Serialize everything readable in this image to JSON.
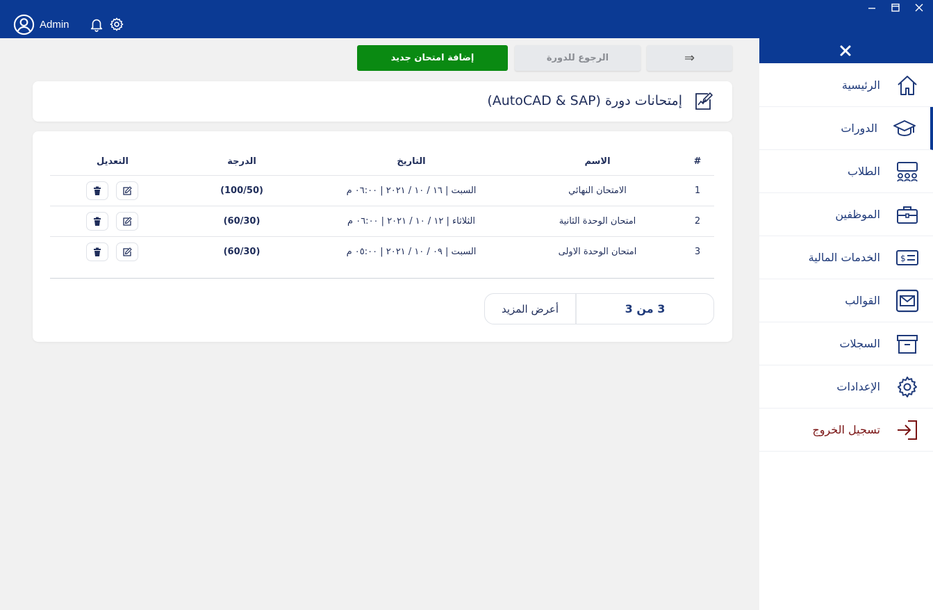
{
  "topbar": {
    "username": "Admin"
  },
  "sidebar": {
    "items": [
      {
        "label": "الرئيسية"
      },
      {
        "label": "الدورات"
      },
      {
        "label": "الطلاب"
      },
      {
        "label": "الموظفين"
      },
      {
        "label": "الخدمات المالية"
      },
      {
        "label": "القوالب"
      },
      {
        "label": "السجلات"
      },
      {
        "label": "الإعدادات"
      },
      {
        "label": "تسجيل الخروج"
      }
    ],
    "active_index": 1
  },
  "toolbar": {
    "add_label": "إضافة امتحان جديد",
    "back_label": "الرجوع للدورة",
    "arrow_label": "⇒"
  },
  "page": {
    "title": "إمتحانات دورة (AutoCAD & SAP)"
  },
  "table": {
    "headers": {
      "index": "#",
      "name": "الاسم",
      "date": "التاريخ",
      "grade": "الدرجة",
      "edit": "التعديل"
    },
    "rows": [
      {
        "index": "1",
        "name": "الامتحان النهائي",
        "date": "السبت | ١٦ / ١٠ / ٢٠٢١ | ٠٦:٠٠ م",
        "grade": "(100/50)"
      },
      {
        "index": "2",
        "name": "امتحان الوحدة الثانية",
        "date": "الثلاثاء | ١٢ / ١٠ / ٢٠٢١ | ٠٦:٠٠ م",
        "grade": "(60/30)"
      },
      {
        "index": "3",
        "name": "امتحان الوحدة الاولى",
        "date": "السبت | ٠٩ / ١٠ / ٢٠٢١ | ٠٥:٠٠ م",
        "grade": "(60/30)"
      }
    ]
  },
  "pager": {
    "more_label": "أعرض المزيد",
    "count_label": "3 من 3"
  },
  "colors": {
    "primary": "#0b3a94",
    "add": "#0a8a12",
    "logout": "#7a1414"
  }
}
